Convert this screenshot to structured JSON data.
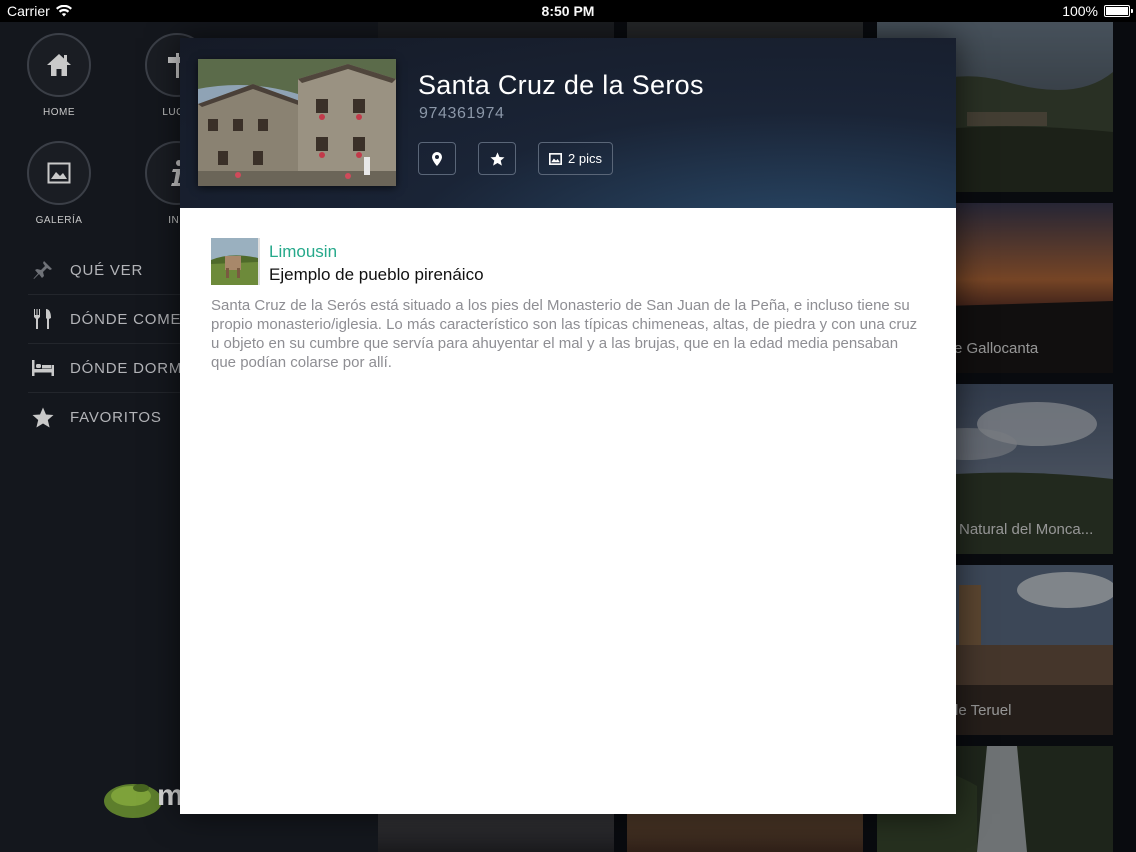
{
  "status_bar": {
    "carrier": "Carrier",
    "time": "8:50 PM",
    "battery": "100%"
  },
  "sidebar": {
    "grid_buttons": [
      {
        "label": "HOME",
        "icon": "home-icon"
      },
      {
        "label": "LUGA",
        "icon": "signpost-icon"
      },
      {
        "label": "GALERÍA",
        "icon": "image-icon"
      },
      {
        "label": "INF",
        "icon": "info-icon"
      }
    ],
    "menu": [
      {
        "label": "QUÉ VER",
        "icon": "pushpin-icon"
      },
      {
        "label": "DÓNDE COMER",
        "icon": "cutlery-icon"
      },
      {
        "label": "DÓNDE DORMIR",
        "icon": "bed-icon"
      },
      {
        "label": "FAVORITOS",
        "icon": "star-icon"
      }
    ],
    "logo_text": "m"
  },
  "background_tiles": {
    "captions": [
      "e Gallocanta",
      "Natural del Monca...",
      "le Teruel"
    ]
  },
  "modal": {
    "title": "Santa Cruz de la Seros",
    "phone": "974361974",
    "actions": {
      "map_icon": "map-pin-icon",
      "favorite_icon": "star-icon",
      "pics_label": "2 pics"
    },
    "author": "Limousin",
    "subtitle": "Ejemplo de pueblo pirenáico",
    "description": "Santa Cruz de la Serós está situado a los pies del Monasterio de San Juan de la Peña, e incluso tiene su propio monasterio/iglesia. Lo más característico son las típicas chimeneas, altas, de piedra y con una cruz u objeto en su cumbre que servía para ahuyentar el mal y a las brujas, que en la edad media pensaban que podían colarse por allí."
  }
}
